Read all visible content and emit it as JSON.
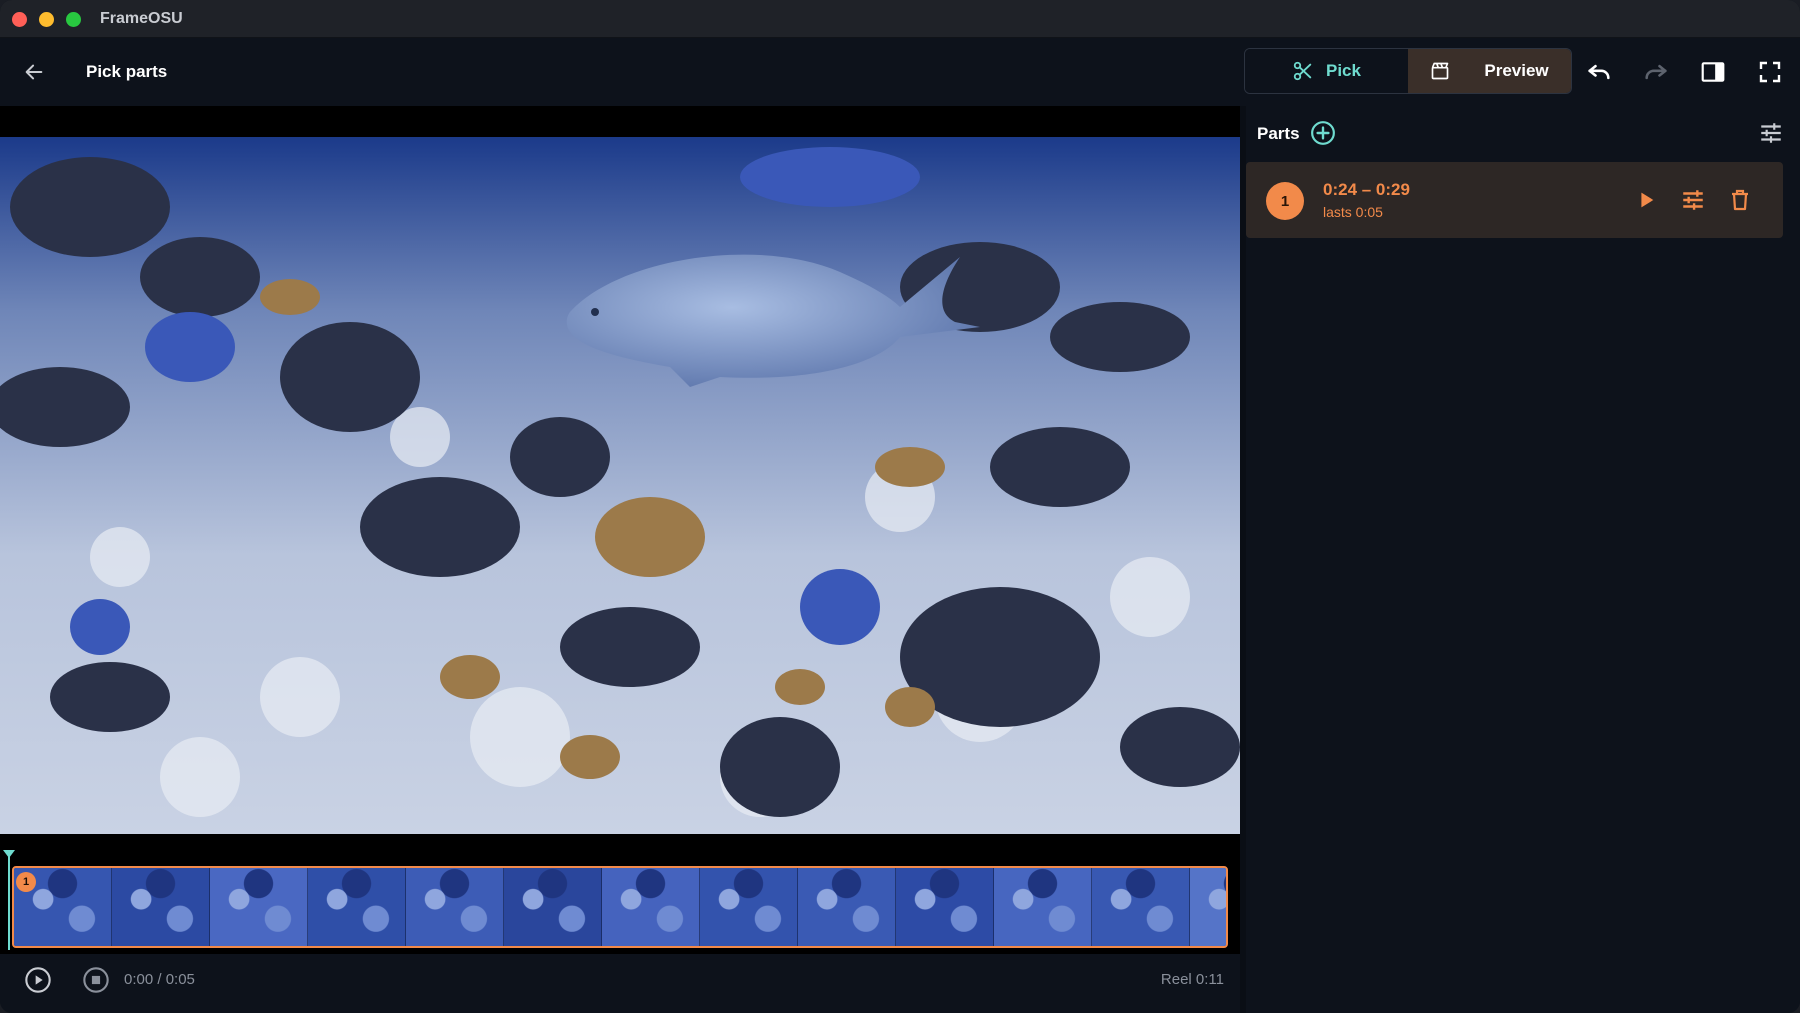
{
  "app": {
    "title": "FrameOSU"
  },
  "header": {
    "back_icon": "arrow-left-icon",
    "title": "Pick parts",
    "mode_tabs": [
      {
        "label": "Pick",
        "icon": "scissors-icon",
        "active": true
      },
      {
        "label": "Preview",
        "icon": "clapperboard-icon",
        "active": false
      }
    ],
    "tools": [
      "undo-icon",
      "redo-icon",
      "panel-right-icon",
      "fullscreen-icon"
    ]
  },
  "player": {
    "time": "0:00 / 0:05",
    "reel": "Reel 0:11",
    "progress": 0.0
  },
  "timeline": {
    "marker_label": "1"
  },
  "parts_panel": {
    "title": "Parts",
    "parts": [
      {
        "number": "1",
        "range": "0:24 – 0:29",
        "duration": "lasts 0:05"
      }
    ]
  },
  "colors": {
    "accent_teal": "#6fdbcf",
    "accent_orange": "#f28a4a",
    "background": "#0d121b"
  }
}
